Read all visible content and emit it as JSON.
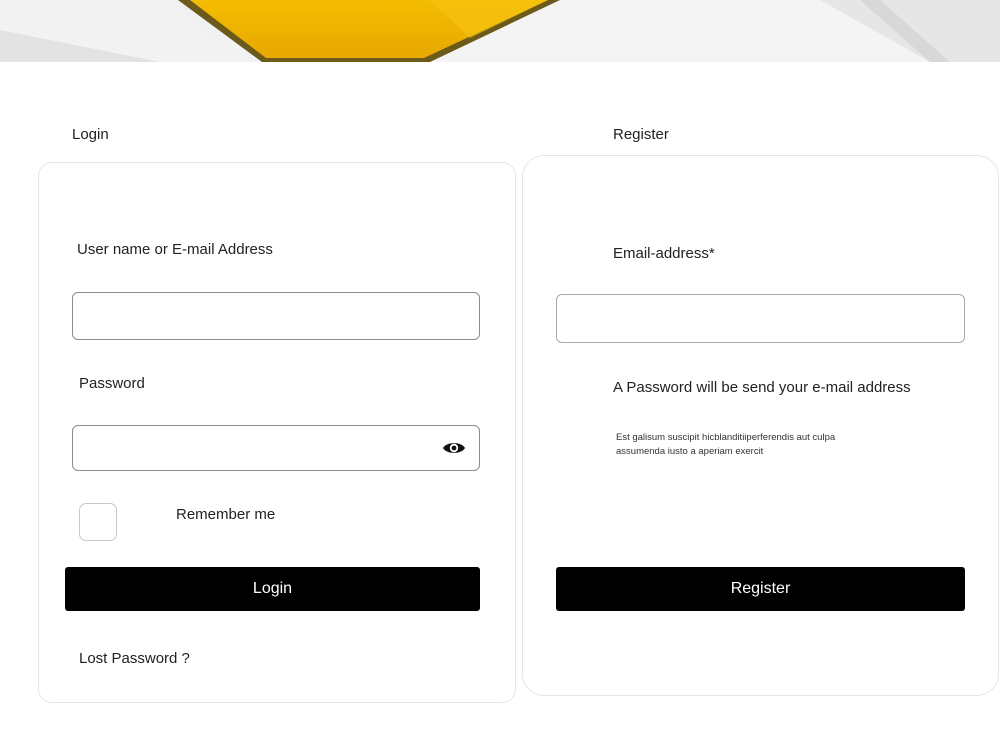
{
  "login": {
    "section_title": "Login",
    "username_label": "User name or E-mail Address",
    "username_value": "",
    "password_label": "Password",
    "password_value": "",
    "password_toggle_icon": "eye-icon",
    "remember_label": "Remember me",
    "remember_checked": false,
    "submit_label": "Login",
    "lost_password_link": "Lost Password ?"
  },
  "register": {
    "section_title": "Register",
    "email_label": "Email-address*",
    "email_value": "",
    "password_note": "A Password will be send your e-mail  address",
    "description": "Est galisum suscipit hicblanditiiperferendis aut culpa assumenda iusto a aperiam exercit",
    "submit_label": "Register"
  },
  "colors": {
    "accent_yellow": "#f0b400",
    "button_bg": "#000000",
    "button_text": "#ffffff"
  }
}
